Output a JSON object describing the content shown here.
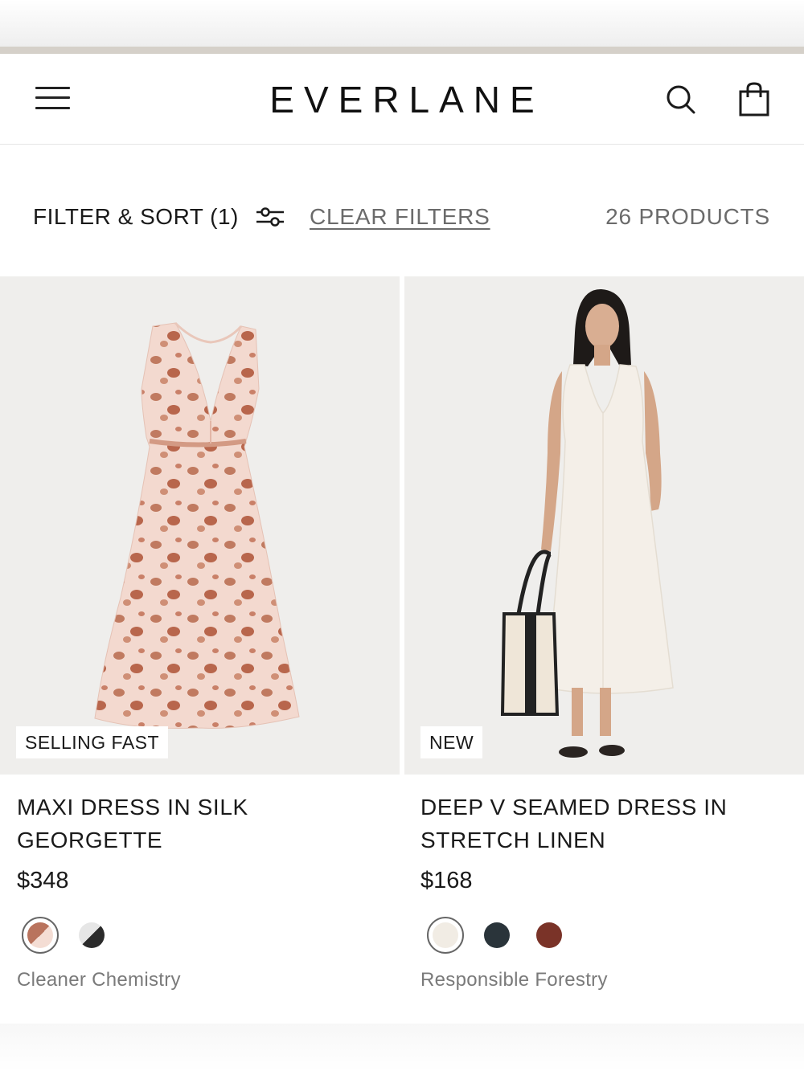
{
  "header": {
    "logo": "EVERLANE",
    "icons": {
      "menu": "hamburger-menu-icon",
      "search": "search-icon",
      "bag": "shopping-bag-icon"
    }
  },
  "filters": {
    "filter_sort_label": "FILTER & SORT (1)",
    "clear_label": "CLEAR FILTERS",
    "product_count": "26 PRODUCTS"
  },
  "products": [
    {
      "badge": "SELLING FAST",
      "title": "MAXI DRESS IN SILK GEORGETTE",
      "price": "$348",
      "swatches": [
        {
          "colors": [
            "#b9735d",
            "#f4ddd4"
          ],
          "selected": true
        },
        {
          "colors": [
            "#2b2b2b",
            "#e6e6e6"
          ],
          "selected": false
        }
      ],
      "sustainability": "Cleaner Chemistry"
    },
    {
      "badge": "NEW",
      "title": "DEEP V SEAMED DRESS IN STRETCH LINEN",
      "price": "$168",
      "swatches": [
        {
          "colors": [
            "#f1ece4"
          ],
          "selected": true
        },
        {
          "colors": [
            "#2a343a"
          ],
          "selected": false
        },
        {
          "colors": [
            "#7a3328"
          ],
          "selected": false
        }
      ],
      "sustainability": "Responsible Forestry"
    }
  ],
  "colors": {
    "text": "#1a1a1a",
    "muted": "#6b6b6b",
    "image_bg": "#efeeec"
  }
}
